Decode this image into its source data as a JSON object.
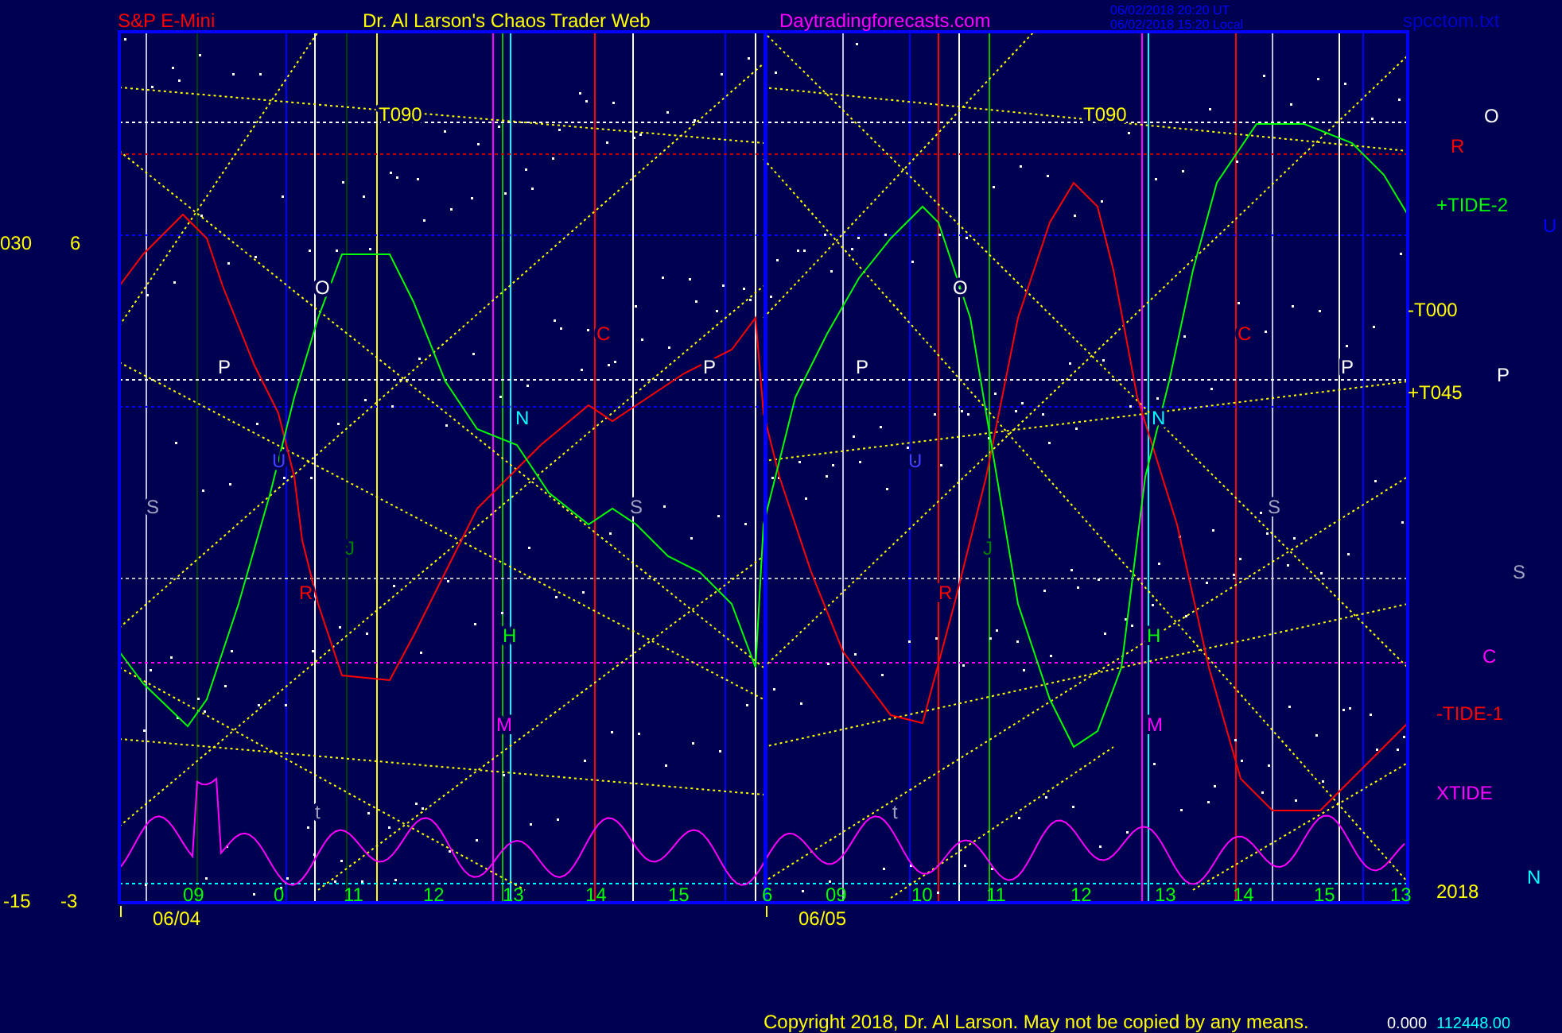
{
  "header": {
    "symbol": "S&P E-Mini",
    "title": "Dr. Al Larson's Chaos Trader Web",
    "site": "Daytradingforecasts.com",
    "time_utc": "06/02/2018 20:20 UT",
    "time_local": "06/02/2018 15:20 Local",
    "file": "spcctom.txt"
  },
  "left_axis": [
    "030",
    "6",
    "-15",
    "-3"
  ],
  "chart_labels": [
    {
      "text": "T090",
      "color": "#ffff00"
    },
    {
      "text": "T090",
      "color": "#ffff00"
    },
    {
      "text": "O",
      "color": "#ffffff"
    },
    {
      "text": "O",
      "color": "#ffffff"
    },
    {
      "text": "P",
      "color": "#ffffff"
    },
    {
      "text": "P",
      "color": "#ffffff"
    },
    {
      "text": "P",
      "color": "#ffffff"
    },
    {
      "text": "P",
      "color": "#ffffff"
    },
    {
      "text": "C",
      "color": "#ff0000"
    },
    {
      "text": "C",
      "color": "#ff0000"
    },
    {
      "text": "N",
      "color": "#00ffff"
    },
    {
      "text": "N",
      "color": "#00ffff"
    },
    {
      "text": "U",
      "color": "#4040ff"
    },
    {
      "text": "U",
      "color": "#4040ff"
    },
    {
      "text": "S",
      "color": "#a0a0c0"
    },
    {
      "text": "S",
      "color": "#a0a0c0"
    },
    {
      "text": "S",
      "color": "#a0a0c0"
    },
    {
      "text": "J",
      "color": "#008000"
    },
    {
      "text": "J",
      "color": "#008000"
    },
    {
      "text": "R",
      "color": "#ff0000"
    },
    {
      "text": "R",
      "color": "#ff0000"
    },
    {
      "text": "H",
      "color": "#00ff00"
    },
    {
      "text": "H",
      "color": "#00ff00"
    },
    {
      "text": "M",
      "color": "#ff00ff"
    },
    {
      "text": "M",
      "color": "#ff00ff"
    },
    {
      "text": "t",
      "color": "#a0a0c0"
    },
    {
      "text": "t",
      "color": "#a0a0c0"
    }
  ],
  "right_labels": [
    {
      "text": "O",
      "color": "#ffffff"
    },
    {
      "text": "R",
      "color": "#ff0000"
    },
    {
      "text": "+TIDE-2",
      "color": "#00ff00"
    },
    {
      "text": "U",
      "color": "#0000ff"
    },
    {
      "text": "-T000",
      "color": "#ffff00"
    },
    {
      "text": "P",
      "color": "#ffffff"
    },
    {
      "text": "+T045",
      "color": "#ffff00"
    },
    {
      "text": "S",
      "color": "#a0a0c0"
    },
    {
      "text": "C",
      "color": "#ff00ff"
    },
    {
      "text": "-TIDE-1",
      "color": "#ff0000"
    },
    {
      "text": "XTIDE",
      "color": "#ff00ff"
    },
    {
      "text": "N",
      "color": "#00ffff"
    },
    {
      "text": "2018",
      "color": "#ffff00"
    }
  ],
  "hours": [
    "09",
    "0",
    "11",
    "12",
    "13",
    "14",
    "15",
    "6",
    "09",
    "10",
    "11",
    "12",
    "13",
    "14",
    "15",
    "13"
  ],
  "dates": [
    "06/04",
    "06/05"
  ],
  "footer": {
    "copyright": "Copyright 2018, Dr. Al Larson. May not be copied by any means.",
    "value_1": "0.000",
    "value_2": "112448.00"
  }
}
